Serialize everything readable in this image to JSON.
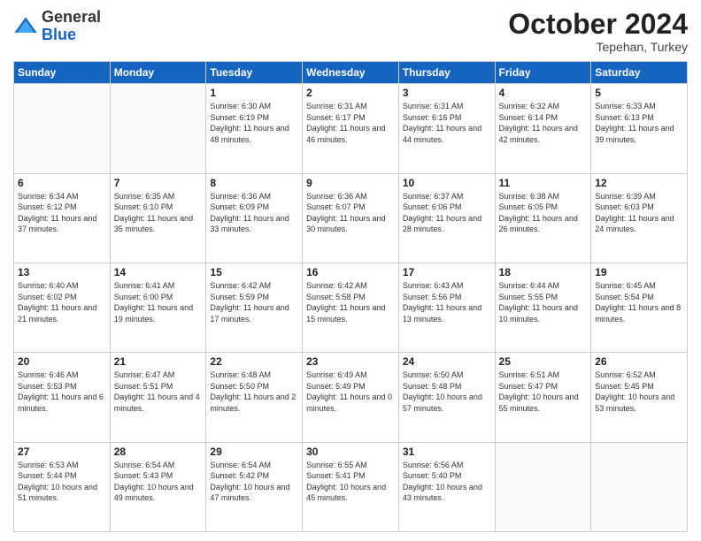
{
  "logo": {
    "line1": "General",
    "line2": "Blue"
  },
  "header": {
    "month": "October 2024",
    "location": "Tepehan, Turkey"
  },
  "weekdays": [
    "Sunday",
    "Monday",
    "Tuesday",
    "Wednesday",
    "Thursday",
    "Friday",
    "Saturday"
  ],
  "weeks": [
    [
      {
        "day": "",
        "detail": ""
      },
      {
        "day": "",
        "detail": ""
      },
      {
        "day": "1",
        "detail": "Sunrise: 6:30 AM\nSunset: 6:19 PM\nDaylight: 11 hours and 48 minutes."
      },
      {
        "day": "2",
        "detail": "Sunrise: 6:31 AM\nSunset: 6:17 PM\nDaylight: 11 hours and 46 minutes."
      },
      {
        "day": "3",
        "detail": "Sunrise: 6:31 AM\nSunset: 6:16 PM\nDaylight: 11 hours and 44 minutes."
      },
      {
        "day": "4",
        "detail": "Sunrise: 6:32 AM\nSunset: 6:14 PM\nDaylight: 11 hours and 42 minutes."
      },
      {
        "day": "5",
        "detail": "Sunrise: 6:33 AM\nSunset: 6:13 PM\nDaylight: 11 hours and 39 minutes."
      }
    ],
    [
      {
        "day": "6",
        "detail": "Sunrise: 6:34 AM\nSunset: 6:12 PM\nDaylight: 11 hours and 37 minutes."
      },
      {
        "day": "7",
        "detail": "Sunrise: 6:35 AM\nSunset: 6:10 PM\nDaylight: 11 hours and 35 minutes."
      },
      {
        "day": "8",
        "detail": "Sunrise: 6:36 AM\nSunset: 6:09 PM\nDaylight: 11 hours and 33 minutes."
      },
      {
        "day": "9",
        "detail": "Sunrise: 6:36 AM\nSunset: 6:07 PM\nDaylight: 11 hours and 30 minutes."
      },
      {
        "day": "10",
        "detail": "Sunrise: 6:37 AM\nSunset: 6:06 PM\nDaylight: 11 hours and 28 minutes."
      },
      {
        "day": "11",
        "detail": "Sunrise: 6:38 AM\nSunset: 6:05 PM\nDaylight: 11 hours and 26 minutes."
      },
      {
        "day": "12",
        "detail": "Sunrise: 6:39 AM\nSunset: 6:03 PM\nDaylight: 11 hours and 24 minutes."
      }
    ],
    [
      {
        "day": "13",
        "detail": "Sunrise: 6:40 AM\nSunset: 6:02 PM\nDaylight: 11 hours and 21 minutes."
      },
      {
        "day": "14",
        "detail": "Sunrise: 6:41 AM\nSunset: 6:00 PM\nDaylight: 11 hours and 19 minutes."
      },
      {
        "day": "15",
        "detail": "Sunrise: 6:42 AM\nSunset: 5:59 PM\nDaylight: 11 hours and 17 minutes."
      },
      {
        "day": "16",
        "detail": "Sunrise: 6:42 AM\nSunset: 5:58 PM\nDaylight: 11 hours and 15 minutes."
      },
      {
        "day": "17",
        "detail": "Sunrise: 6:43 AM\nSunset: 5:56 PM\nDaylight: 11 hours and 13 minutes."
      },
      {
        "day": "18",
        "detail": "Sunrise: 6:44 AM\nSunset: 5:55 PM\nDaylight: 11 hours and 10 minutes."
      },
      {
        "day": "19",
        "detail": "Sunrise: 6:45 AM\nSunset: 5:54 PM\nDaylight: 11 hours and 8 minutes."
      }
    ],
    [
      {
        "day": "20",
        "detail": "Sunrise: 6:46 AM\nSunset: 5:53 PM\nDaylight: 11 hours and 6 minutes."
      },
      {
        "day": "21",
        "detail": "Sunrise: 6:47 AM\nSunset: 5:51 PM\nDaylight: 11 hours and 4 minutes."
      },
      {
        "day": "22",
        "detail": "Sunrise: 6:48 AM\nSunset: 5:50 PM\nDaylight: 11 hours and 2 minutes."
      },
      {
        "day": "23",
        "detail": "Sunrise: 6:49 AM\nSunset: 5:49 PM\nDaylight: 11 hours and 0 minutes."
      },
      {
        "day": "24",
        "detail": "Sunrise: 6:50 AM\nSunset: 5:48 PM\nDaylight: 10 hours and 57 minutes."
      },
      {
        "day": "25",
        "detail": "Sunrise: 6:51 AM\nSunset: 5:47 PM\nDaylight: 10 hours and 55 minutes."
      },
      {
        "day": "26",
        "detail": "Sunrise: 6:52 AM\nSunset: 5:45 PM\nDaylight: 10 hours and 53 minutes."
      }
    ],
    [
      {
        "day": "27",
        "detail": "Sunrise: 6:53 AM\nSunset: 5:44 PM\nDaylight: 10 hours and 51 minutes."
      },
      {
        "day": "28",
        "detail": "Sunrise: 6:54 AM\nSunset: 5:43 PM\nDaylight: 10 hours and 49 minutes."
      },
      {
        "day": "29",
        "detail": "Sunrise: 6:54 AM\nSunset: 5:42 PM\nDaylight: 10 hours and 47 minutes."
      },
      {
        "day": "30",
        "detail": "Sunrise: 6:55 AM\nSunset: 5:41 PM\nDaylight: 10 hours and 45 minutes."
      },
      {
        "day": "31",
        "detail": "Sunrise: 6:56 AM\nSunset: 5:40 PM\nDaylight: 10 hours and 43 minutes."
      },
      {
        "day": "",
        "detail": ""
      },
      {
        "day": "",
        "detail": ""
      }
    ]
  ]
}
